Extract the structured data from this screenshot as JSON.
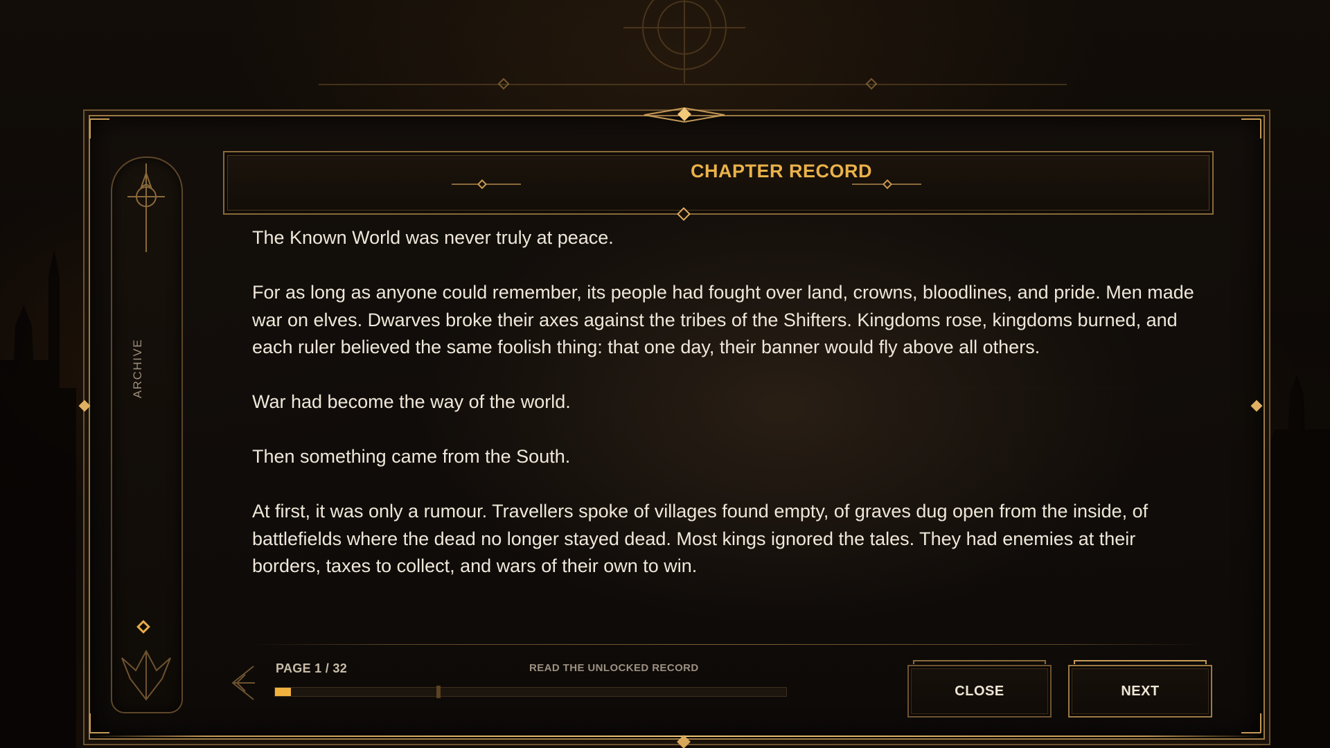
{
  "sidebar": {
    "label": "ARCHIVE"
  },
  "header": {
    "title": "CHAPTER RECORD"
  },
  "record": {
    "paragraphs": [
      "The Known World was never truly at peace.",
      "For as long as anyone could remember, its people had fought over land, crowns, bloodlines, and pride. Men made war on elves. Dwarves broke their axes against the tribes of the Shifters. Kingdoms rose, kingdoms burned, and each ruler believed the same foolish thing: that one day, their banner would fly above all others.",
      "War had become the way of the world.",
      "Then something came from the South.",
      "At first, it was only a rumour. Travellers spoke of villages found empty, of graves dug open from the inside, of battlefields where the dead no longer stayed dead. Most kings ignored the tales. They had enemies at their borders, taxes to collect, and wars of their own to win."
    ]
  },
  "footer": {
    "page_label": "PAGE 1 / 32",
    "hint": "READ THE UNLOCKED RECORD",
    "progress_fraction": 0.031
  },
  "buttons": {
    "close_label": "CLOSE",
    "next_label": "NEXT"
  },
  "theme": {
    "accent": "#eab24a",
    "frame": "#9c7a45",
    "text": "#efe8da"
  },
  "icons": {
    "sidebar_top": "compass-cross-icon",
    "sidebar_marker": "diamond-icon",
    "sidebar_bottom": "winged-emblem-icon",
    "footer_left": "ornate-arrow-icon"
  }
}
